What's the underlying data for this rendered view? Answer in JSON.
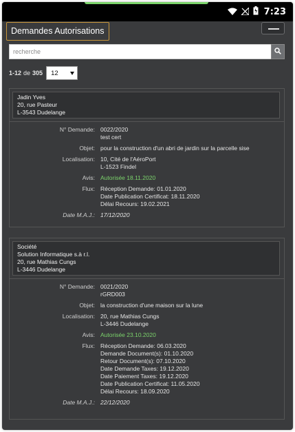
{
  "status_bar": {
    "time": "7:23"
  },
  "app": {
    "title": "Demandes Autorisations"
  },
  "search": {
    "placeholder": "recherche"
  },
  "pager": {
    "range": "1-12",
    "of": "de",
    "total": "305",
    "per_page": "12"
  },
  "labels": {
    "num": "N° Demande:",
    "objet": "Objet:",
    "localisation": "Localisation:",
    "avis": "Avis:",
    "flux": "Flux:",
    "date_maj": "Date M.A.J.:"
  },
  "requests": [
    {
      "applicant": [
        "Jadin Yves",
        "20, rue Pasteur",
        "L-3543 Dudelange"
      ],
      "num": [
        "0022/2020",
        "test cert"
      ],
      "objet": "pour la construction d'un abri de jardin sur la parcelle sise",
      "localisation": [
        "10, Cité de l'AéroPort",
        "L-1523 Findel"
      ],
      "avis": "Autorisée 18.11.2020",
      "flux": [
        "Réception Demande: 01.01.2020",
        "Date Publication Certificat: 18.11.2020",
        "Délai Recours: 19.02.2021"
      ],
      "date_maj": "17/12/2020"
    },
    {
      "applicant": [
        "Société",
        "Solution Informatique s.à r.l.",
        "20, rue Mathias Cungs",
        "L-3446 Dudelange"
      ],
      "num": [
        "0021/2020",
        "rGRD003"
      ],
      "objet": "la construction d'une maison sur la lune",
      "localisation": [
        "20, rue Mathias Cungs",
        "L-3446 Dudelange"
      ],
      "avis": "Autorisée 23.10.2020",
      "flux": [
        "Réception Demande: 06.03.2020",
        "Demande Document(s): 01.10.2020",
        "Retour Document(s): 07.10.2020",
        "Date Demande Taxes: 19.12.2020",
        "Date Paiement Taxes: 19.12.2020",
        "Date Publication Certificat: 11.05.2020",
        "Délai Recours: 18.09.2020"
      ],
      "date_maj": "22/12/2020"
    }
  ],
  "colors": {
    "accent_border": "#c8963a",
    "approved": "#7bd36b",
    "background": "#3a3b3d"
  },
  "icons": [
    "wifi-icon",
    "no-signal-icon",
    "battery-icon",
    "menu-icon",
    "search-icon",
    "caret-down-icon"
  ]
}
